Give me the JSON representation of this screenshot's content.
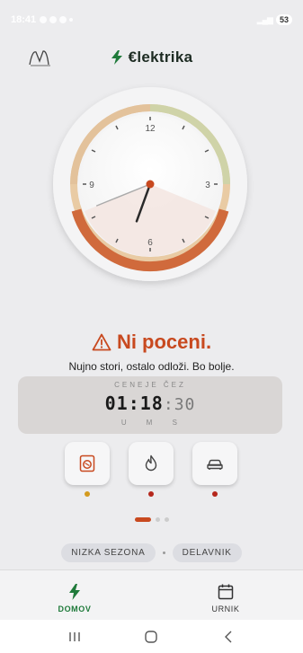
{
  "status_bar": {
    "time": "18:41",
    "battery": "53"
  },
  "header": {
    "logo_text": "M",
    "brand_name": "€lektrika"
  },
  "clock": {
    "numbers": [
      "12",
      "3",
      "6",
      "9"
    ],
    "hour_hand_angle": 200,
    "minute_hand_angle": 248,
    "colors": {
      "cheap": "#c8d6a8",
      "mid": "#e6c49a",
      "expensive": "#d06a3c",
      "accent": "#c8491f"
    }
  },
  "message": {
    "headline": "Ni poceni.",
    "subline": "Nujno stori, ostalo odloži. Bo bolje."
  },
  "countdown": {
    "label": "CENEJE ČEZ",
    "hours": "01",
    "minutes": "18",
    "seconds": "30",
    "units": [
      "U",
      "M",
      "S"
    ]
  },
  "appliances": [
    {
      "name": "washing-machine",
      "status_color": "#d39a1e"
    },
    {
      "name": "flame",
      "status_color": "#b5271c"
    },
    {
      "name": "car",
      "status_color": "#b5271c"
    }
  ],
  "pager": {
    "pages": 3,
    "active": 0
  },
  "chips": {
    "season": "NIZKA SEZONA",
    "day": "DELAVNIK"
  },
  "nav": {
    "home": "DOMOV",
    "schedule": "URNIK"
  }
}
